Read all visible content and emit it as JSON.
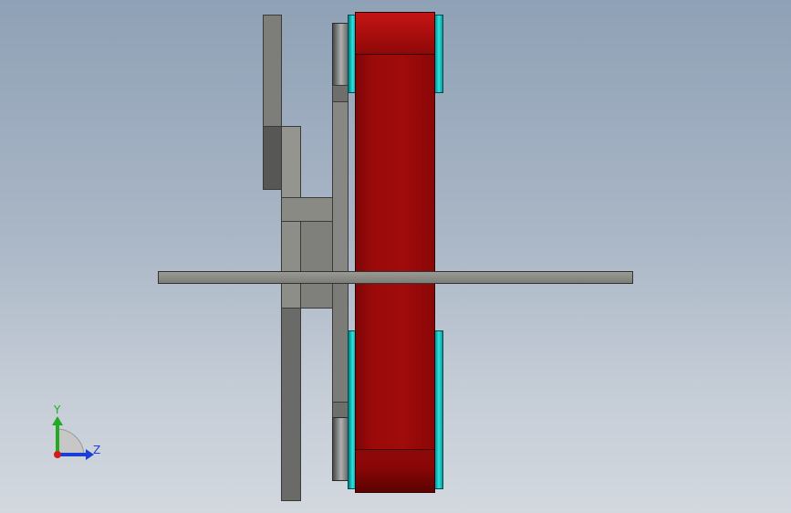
{
  "window": {
    "view_type": "CAD model view (side elevation)"
  },
  "triad": {
    "y_label": "Y",
    "z_label": "Z",
    "colors": {
      "y_axis": "#22aa22",
      "z_axis": "#1a3fd6",
      "x_axis": "#d21c1c"
    }
  },
  "colors": {
    "background_top": "#8fa1b6",
    "background_bottom": "#d3d8df",
    "belt_red": "#9b0a0a",
    "flange_teal": "#14c8c8",
    "plate_gray": "#8a8a84",
    "plate_dark": "#5a5a58",
    "shaft_gray": "#85857f"
  }
}
